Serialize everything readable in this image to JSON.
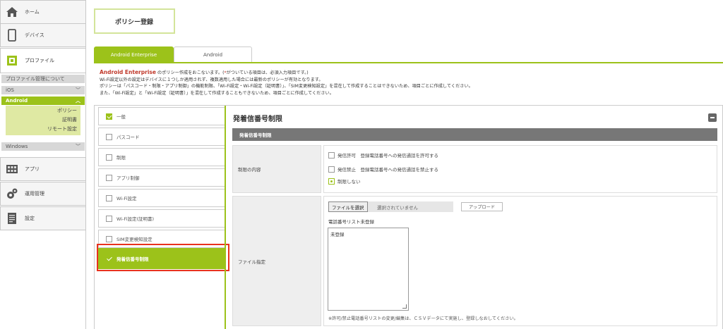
{
  "sidebar": {
    "home": "ホーム",
    "device": "デバイス",
    "profile": "プロファイル",
    "profile_about": "プロファイル管理について",
    "ios": "iOS",
    "android": "Android",
    "android_sub": [
      "ポリシー",
      "証明書",
      "リモート設定"
    ],
    "windows": "Windows",
    "app": "アプリ",
    "operation": "運用管理",
    "settings": "設定"
  },
  "page_title": "ポリシー登録",
  "tabs": [
    {
      "label": "Android Enterprise",
      "active": true
    },
    {
      "label": "Android",
      "active": false
    }
  ],
  "notes": {
    "brand": "Android Enterprise",
    "line1_rest": " のポリシー作成をおこないます。(",
    "req_mark": "*",
    "line1_end": "がついている項目は、必須入力項目です。)",
    "line2": "Wi-Fi設定以外の設定はデバイスに１つしか適用されず、複数適用した場合には最新のポリシーが有効となります。",
    "line3": "ポリシーは「パスコード・制限・アプリ制御」の機能制限、「Wi-Fi設定・Wi-Fi設定（証明書）」、「SIM変更検知設定」を混在して作成することはできないため、項目ごとに作成してください。",
    "line4": "また、「Wi-Fi設定」と「Wi-Fi設定（証明書）」を混在して作成することもできないため、項目ごとに作成してください。"
  },
  "policy_items": [
    {
      "label": "一般",
      "checked": true
    },
    {
      "label": "パスコード",
      "checked": false
    },
    {
      "label": "制限",
      "checked": false
    },
    {
      "label": "アプリ制御",
      "checked": false
    },
    {
      "label": "Wi-Fi設定",
      "checked": false
    },
    {
      "label": "Wi-Fi設定(証明書)",
      "checked": false
    },
    {
      "label": "SIM変更検知設定",
      "checked": false
    },
    {
      "label": "発着信番号制限",
      "selected": true
    }
  ],
  "section": {
    "title": "発着信番号制限",
    "bar": "発着信番号制限",
    "restriction_label": "制限の内容",
    "options": [
      {
        "label": "発信許可　登録電話番号への発信通話を許可する",
        "selected": false
      },
      {
        "label": "発信禁止　登録電話番号への発信通話を禁止する",
        "selected": false
      },
      {
        "label": "制限しない",
        "selected": true
      }
    ],
    "file_label": "ファイル指定",
    "file_button": "ファイルを選択",
    "file_none": "選択されていません",
    "upload_button": "アップロード",
    "list_status": "電話番号リスト未登録",
    "textarea_value": "未登録",
    "foot_note": "※許可/禁止電話番号リストの変更/編集は、ＣＳＶデータにて実施し、登録しなおしてください。"
  },
  "colors": {
    "accent": "#9cc21a",
    "highlight": "#e8321e",
    "brand_text": "#c0392b"
  }
}
